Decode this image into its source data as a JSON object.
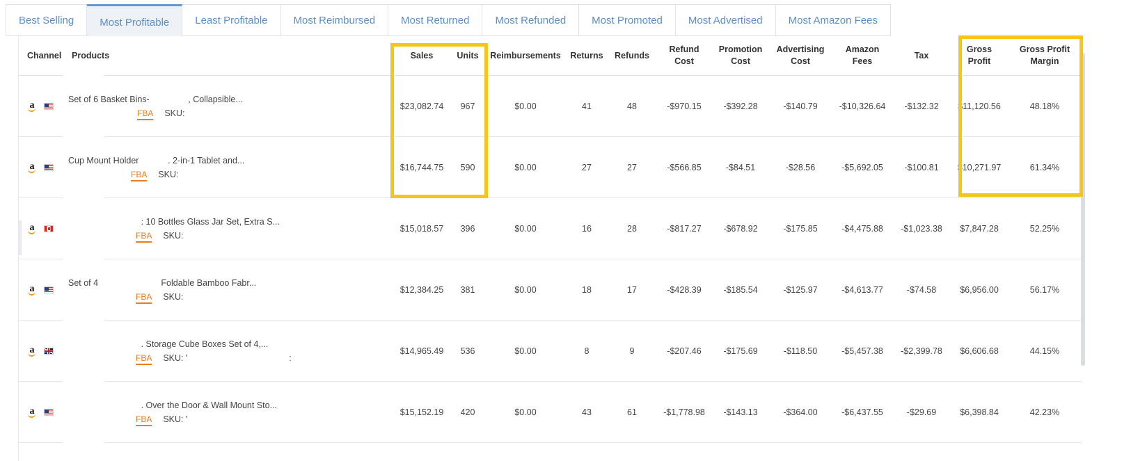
{
  "tabs": [
    {
      "label": "Best Selling",
      "active": false
    },
    {
      "label": "Most Profitable",
      "active": true
    },
    {
      "label": "Least Profitable",
      "active": false
    },
    {
      "label": "Most Reimbursed",
      "active": false
    },
    {
      "label": "Most Returned",
      "active": false
    },
    {
      "label": "Most Refunded",
      "active": false
    },
    {
      "label": "Most Promoted",
      "active": false
    },
    {
      "label": "Most Advertised",
      "active": false
    },
    {
      "label": "Most Amazon Fees",
      "active": false
    }
  ],
  "columns": {
    "channel": "Channel",
    "products": "Products",
    "sales": "Sales",
    "units": "Units",
    "reimbursements": "Reimbursements",
    "returns": "Returns",
    "refunds": "Refunds",
    "refund_cost": [
      "Refund",
      "Cost"
    ],
    "promotion_cost": [
      "Promotion",
      "Cost"
    ],
    "advertising_cost": [
      "Advertising",
      "Cost"
    ],
    "amazon_fees": [
      "Amazon",
      "Fees"
    ],
    "tax": "Tax",
    "gross_profit": [
      "Gross",
      "Profit"
    ],
    "gross_profit_margin": [
      "Gross Profit",
      "Margin"
    ]
  },
  "fba_label": "FBA",
  "sku_label": "SKU:",
  "highlight_color": "#f5c518",
  "accent_color": "#5b8fc7",
  "rows": [
    {
      "marketplace": "us",
      "title": "Set of 6 Basket Bins-                , Collapsible...",
      "sku": "",
      "sales": "$23,082.74",
      "units": "967",
      "reimbursements": "$0.00",
      "returns": "41",
      "refunds": "48",
      "refund_cost": "-$970.15",
      "promotion_cost": "-$392.28",
      "advertising_cost": "-$140.79",
      "amazon_fees": "-$10,326.64",
      "tax": "-$132.32",
      "gross_profit": "$11,120.56",
      "gross_profit_margin": "48.18%"
    },
    {
      "marketplace": "us",
      "title": "Cup Mount Holder            . 2-in-1 Tablet and...",
      "sku": "",
      "sales": "$16,744.75",
      "units": "590",
      "reimbursements": "$0.00",
      "returns": "27",
      "refunds": "27",
      "refund_cost": "-$566.85",
      "promotion_cost": "-$84.51",
      "advertising_cost": "-$28.56",
      "amazon_fees": "-$5,692.05",
      "tax": "-$100.81",
      "gross_profit": "$10,271.97",
      "gross_profit_margin": "61.34%"
    },
    {
      "marketplace": "ca",
      "title": "                : 10 Bottles Glass Jar Set, Extra S...",
      "sku": "",
      "sales": "$15,018.57",
      "units": "396",
      "reimbursements": "$0.00",
      "returns": "16",
      "refunds": "28",
      "refund_cost": "-$817.27",
      "promotion_cost": "-$678.92",
      "advertising_cost": "-$175.85",
      "amazon_fees": "-$4,475.88",
      "tax": "-$1,023.38",
      "gross_profit": "$7,847.28",
      "gross_profit_margin": "52.25%"
    },
    {
      "marketplace": "us",
      "title": "Set of 4                          Foldable Bamboo Fabr...",
      "sku": "",
      "sales": "$12,384.25",
      "units": "381",
      "reimbursements": "$0.00",
      "returns": "18",
      "refunds": "17",
      "refund_cost": "-$428.39",
      "promotion_cost": "-$185.54",
      "advertising_cost": "-$125.97",
      "amazon_fees": "-$4,613.77",
      "tax": "-$74.58",
      "gross_profit": "$6,956.00",
      "gross_profit_margin": "56.17%"
    },
    {
      "marketplace": "uk",
      "title": "                . Storage Cube Boxes Set of 4,...",
      "sku": "'                                          :",
      "sales": "$14,965.49",
      "units": "536",
      "reimbursements": "$0.00",
      "returns": "8",
      "refunds": "9",
      "refund_cost": "-$207.46",
      "promotion_cost": "-$175.69",
      "advertising_cost": "-$118.50",
      "amazon_fees": "-$5,457.38",
      "tax": "-$2,399.78",
      "gross_profit": "$6,606.68",
      "gross_profit_margin": "44.15%"
    },
    {
      "marketplace": "us",
      "title": "                . Over the Door & Wall Mount Sto...",
      "sku": "'",
      "sales": "$15,152.19",
      "units": "420",
      "reimbursements": "$0.00",
      "returns": "43",
      "refunds": "61",
      "refund_cost": "-$1,778.98",
      "promotion_cost": "-$143.13",
      "advertising_cost": "-$364.00",
      "amazon_fees": "-$6,437.55",
      "tax": "-$29.69",
      "gross_profit": "$6,398.84",
      "gross_profit_margin": "42.23%"
    }
  ]
}
